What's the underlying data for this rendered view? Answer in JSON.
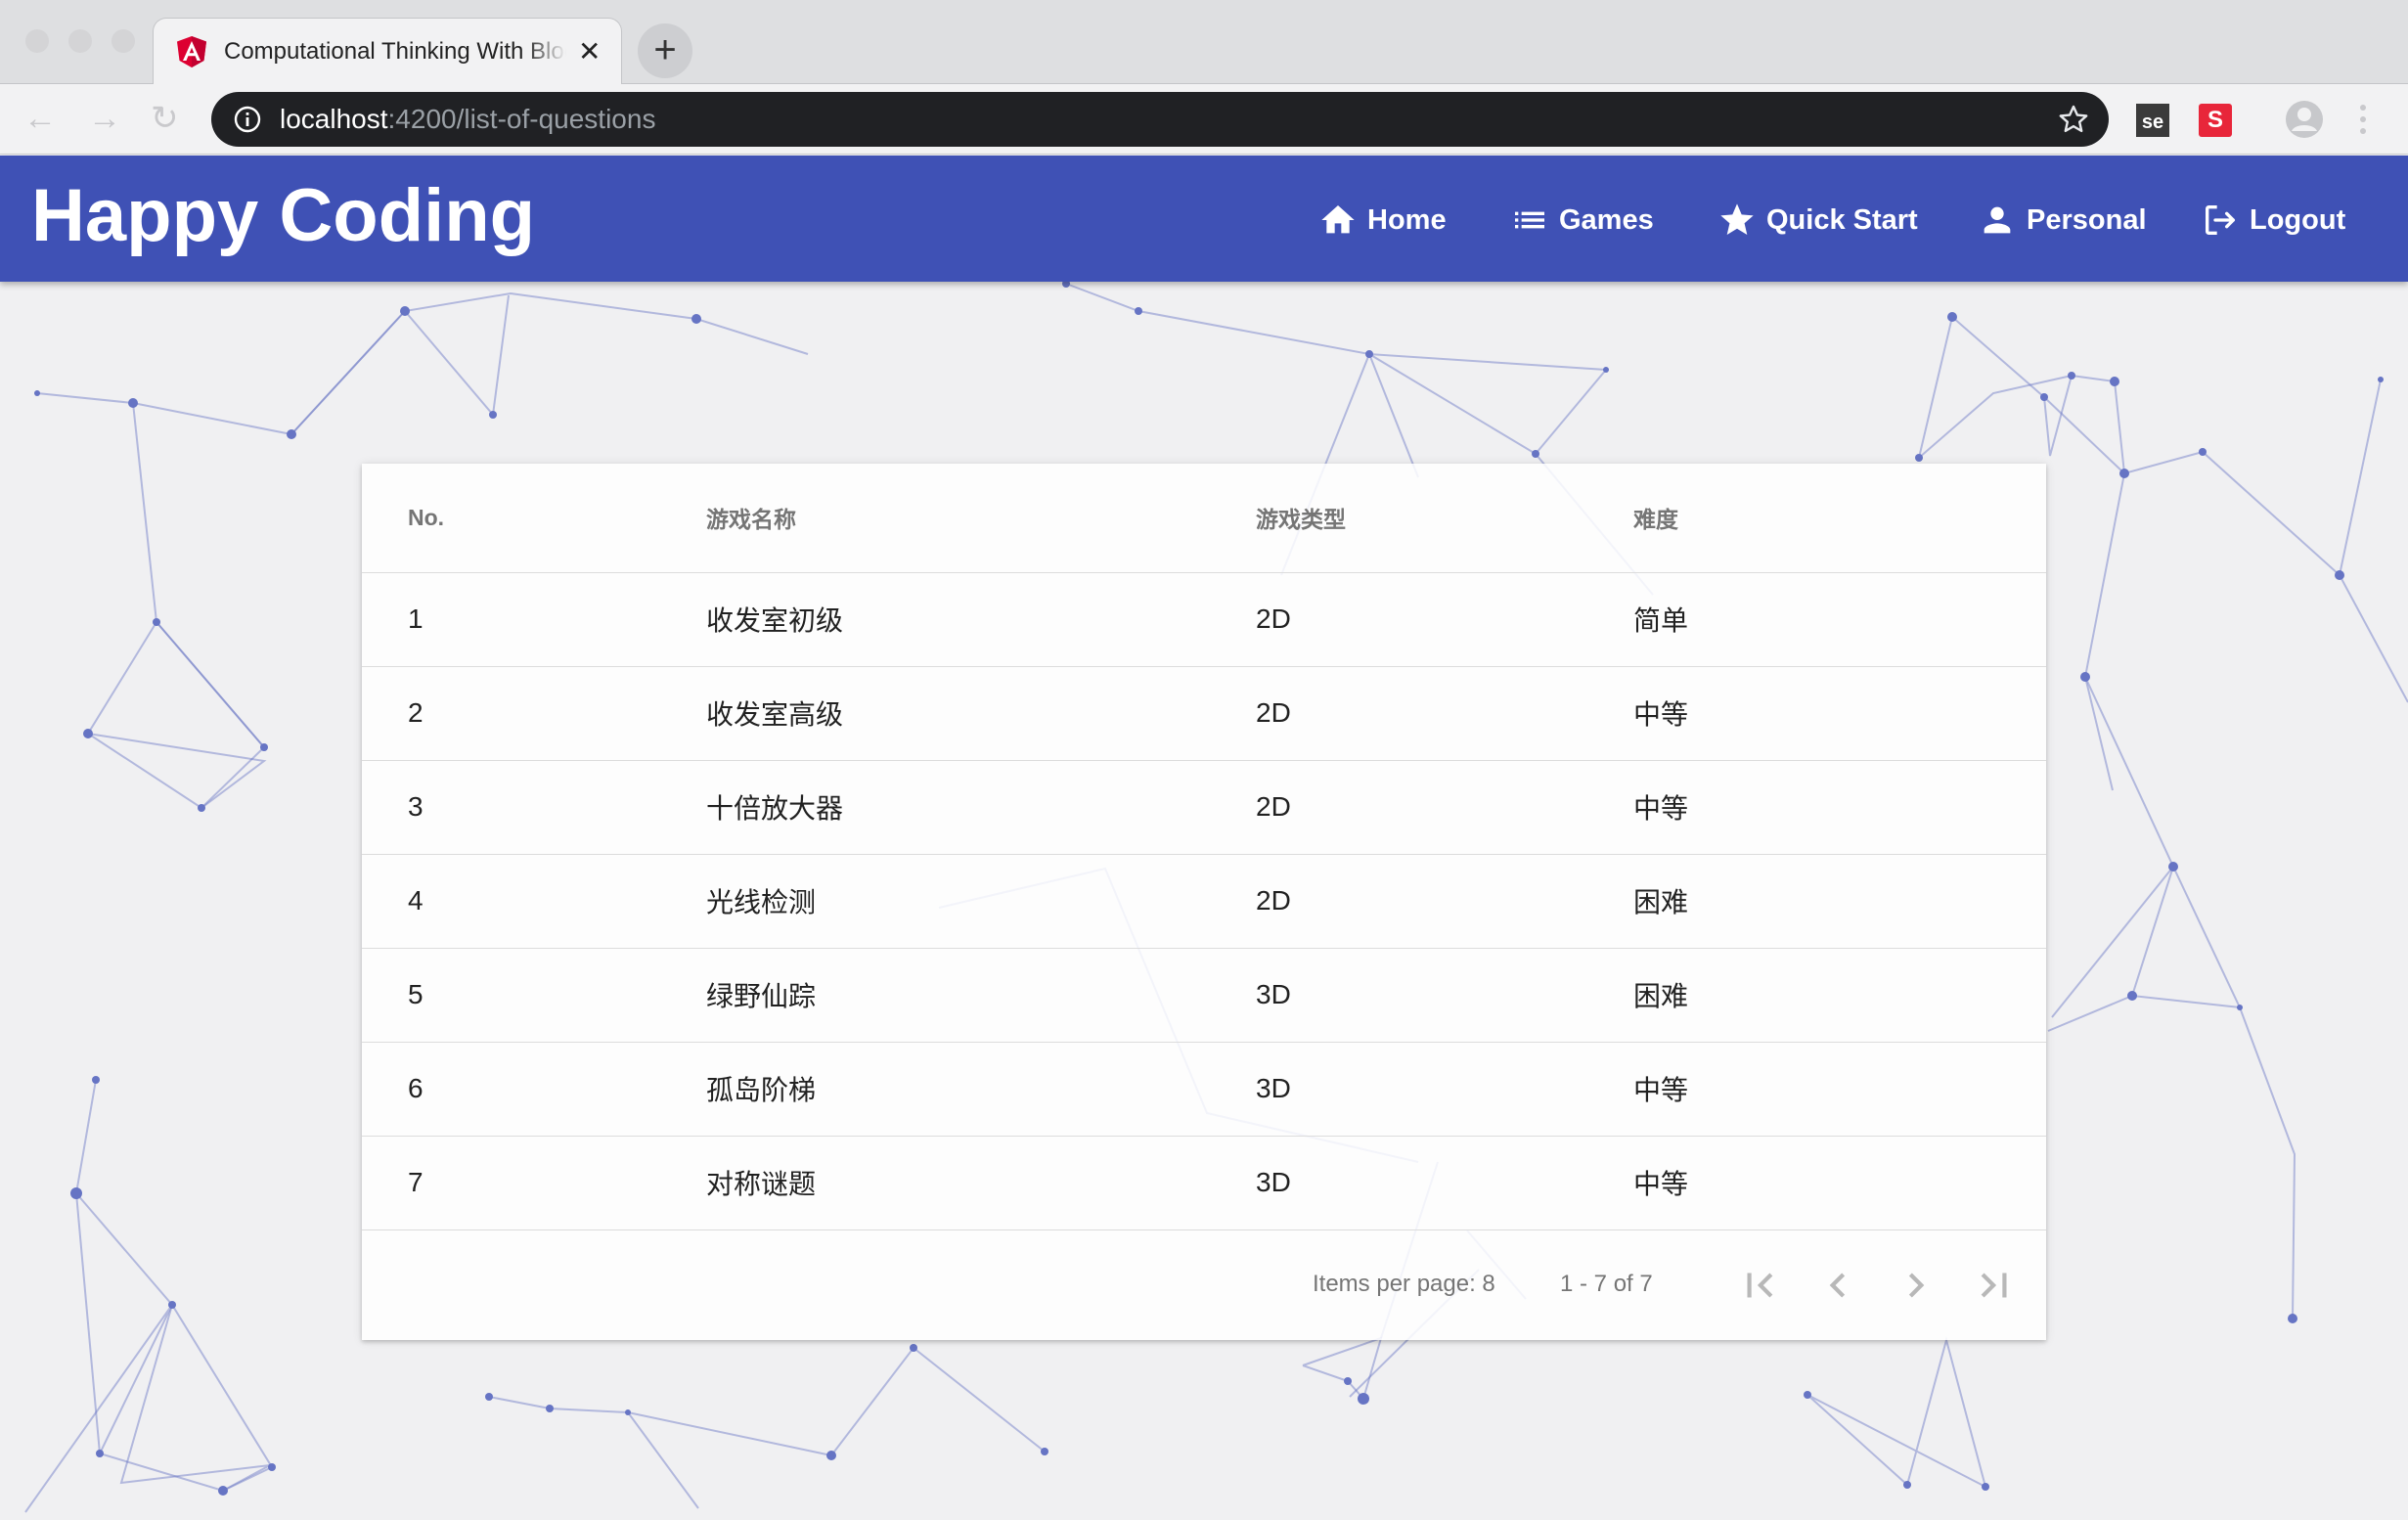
{
  "browser": {
    "tab_title": "Computational Thinking With Blockly",
    "url_host": "localhost",
    "url_path": ":4200/list-of-questions",
    "extension_se_label": "se",
    "extension_s_label": "S"
  },
  "header": {
    "brand": "Happy Coding",
    "nav": {
      "home": "Home",
      "games": "Games",
      "quick_start": "Quick Start",
      "personal": "Personal",
      "logout": "Logout"
    }
  },
  "table": {
    "columns": [
      "No.",
      "游戏名称",
      "游戏类型",
      "难度"
    ],
    "rows": [
      {
        "no": "1",
        "name": "收发室初级",
        "type": "2D",
        "difficulty": "简单"
      },
      {
        "no": "2",
        "name": "收发室高级",
        "type": "2D",
        "difficulty": "中等"
      },
      {
        "no": "3",
        "name": "十倍放大器",
        "type": "2D",
        "difficulty": "中等"
      },
      {
        "no": "4",
        "name": "光线检测",
        "type": "2D",
        "difficulty": "困难"
      },
      {
        "no": "5",
        "name": "绿野仙踪",
        "type": "3D",
        "difficulty": "困难"
      },
      {
        "no": "6",
        "name": "孤岛阶梯",
        "type": "3D",
        "difficulty": "中等"
      },
      {
        "no": "7",
        "name": "对称谜题",
        "type": "3D",
        "difficulty": "中等"
      }
    ]
  },
  "paginator": {
    "items_per_page": "Items per page: 8",
    "range": "1 - 7 of 7"
  },
  "colors": {
    "primary": "#3f51b5",
    "network_line": "#6674c4"
  },
  "icons": {
    "home": "home-icon",
    "games": "list-icon",
    "quick_start": "star-icon",
    "personal": "person-icon",
    "logout": "logout-icon"
  }
}
